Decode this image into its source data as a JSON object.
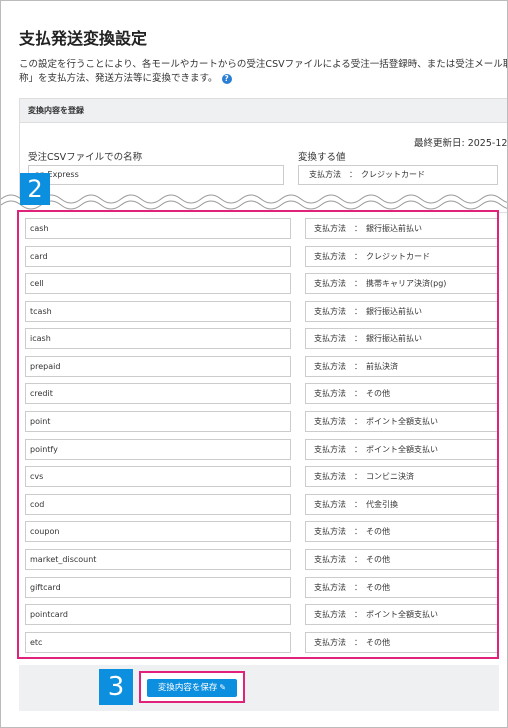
{
  "page": {
    "title": "支払発送変換設定",
    "description_line1": "この設定を行うことにより、各モールやカートからの受注CSVファイルによる受注一括登録時、または受注メール取",
    "description_line2": "称」を支払方法、発送方法等に変換できます。",
    "help_icon": "?"
  },
  "panel": {
    "header": "変換内容を登録",
    "last_updated": "最終更新日: 2025-12",
    "col_name": "受注CSVファイルでの名称",
    "col_value": "変換する値",
    "top_row": {
      "name": "an Express",
      "value": "支払方法　：　クレジットカード"
    }
  },
  "badges": {
    "two": "2",
    "three": "3"
  },
  "rows": [
    {
      "name": "cash",
      "value": "支払方法　：　銀行振込前払い"
    },
    {
      "name": "card",
      "value": "支払方法　：　クレジットカード"
    },
    {
      "name": "cell",
      "value": "支払方法　：　携帯キャリア決済(pg)"
    },
    {
      "name": "tcash",
      "value": "支払方法　：　銀行振込前払い"
    },
    {
      "name": "icash",
      "value": "支払方法　：　銀行振込前払い"
    },
    {
      "name": "prepaid",
      "value": "支払方法　：　前払決済"
    },
    {
      "name": "credit",
      "value": "支払方法　：　その他"
    },
    {
      "name": "point",
      "value": "支払方法　：　ポイント全額支払い"
    },
    {
      "name": "pointfy",
      "value": "支払方法　：　ポイント全額支払い"
    },
    {
      "name": "cvs",
      "value": "支払方法　：　コンビニ決済"
    },
    {
      "name": "cod",
      "value": "支払方法　：　代金引換"
    },
    {
      "name": "coupon",
      "value": "支払方法　：　その他"
    },
    {
      "name": "market_discount",
      "value": "支払方法　：　その他"
    },
    {
      "name": "giftcard",
      "value": "支払方法　：　その他"
    },
    {
      "name": "pointcard",
      "value": "支払方法　：　ポイント全額支払い"
    },
    {
      "name": "etc",
      "value": "支払方法　：　その他"
    }
  ],
  "footer": {
    "save_label": "変換内容を保存"
  },
  "colors": {
    "accent": "#0d8fe0",
    "highlight": "#e0227a",
    "panel_bg": "#eef0f2"
  }
}
